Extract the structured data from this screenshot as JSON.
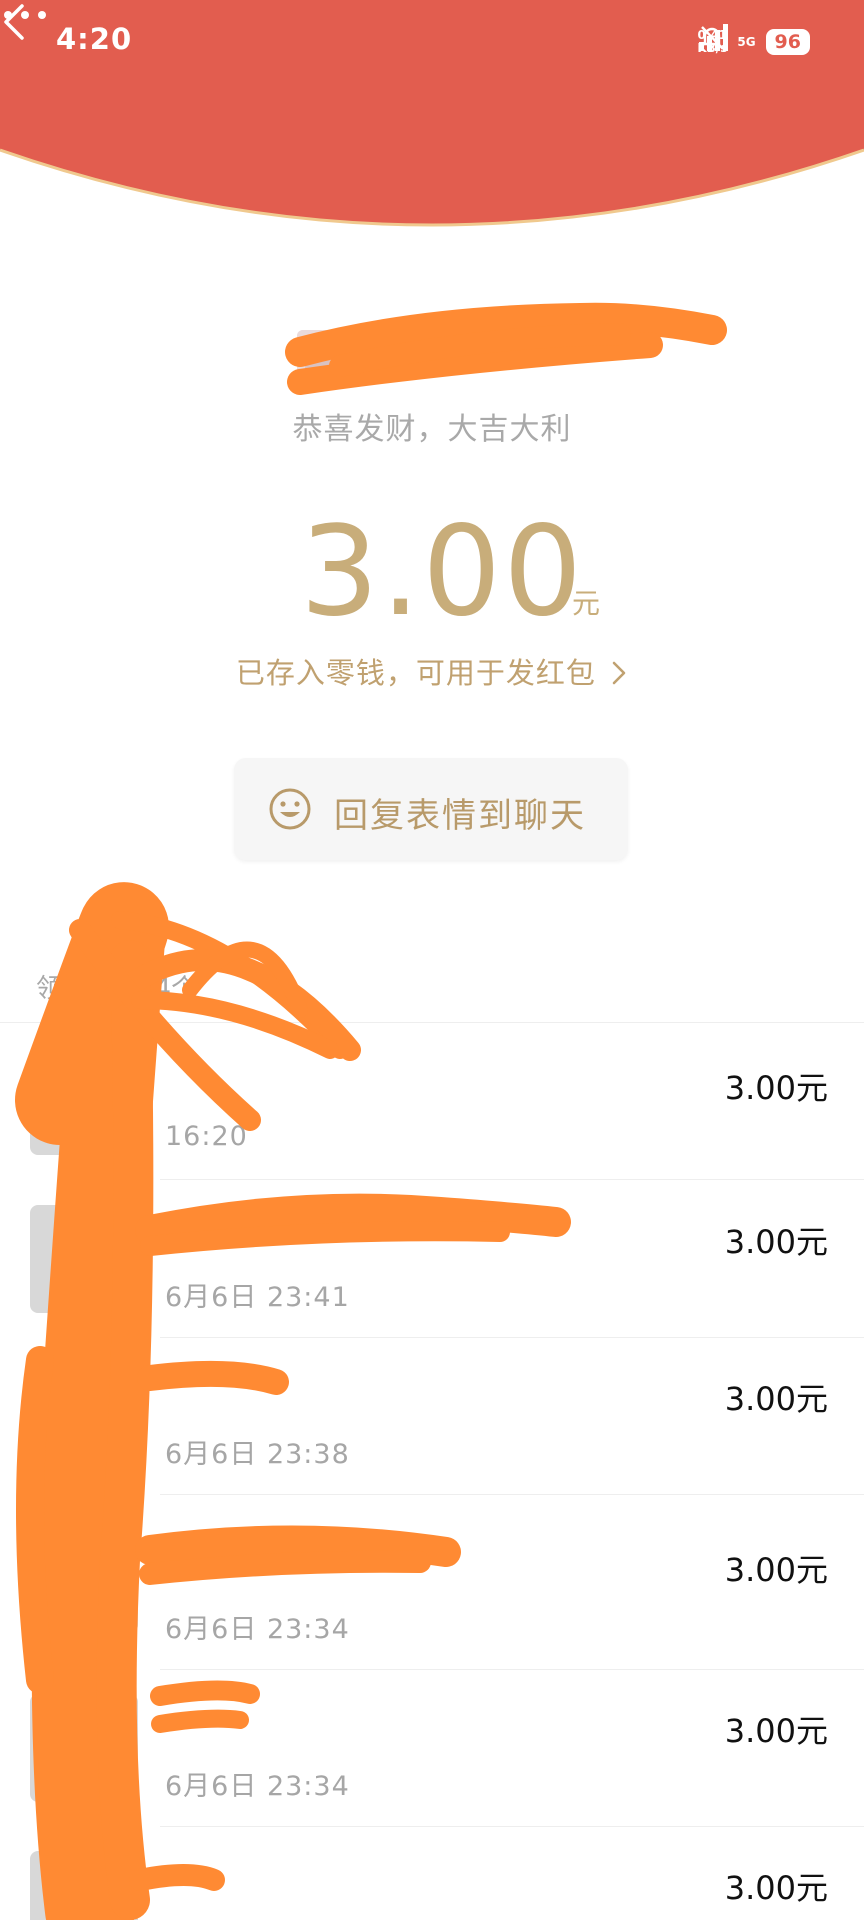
{
  "status_bar": {
    "time": "4:20",
    "net_speed_value": "0.41",
    "net_speed_unit": "KB/s",
    "network": "5G",
    "battery": "96"
  },
  "nav": {
    "back_icon": "chevron-left-icon",
    "more_icon": "more-dots-icon"
  },
  "packet": {
    "greeting": "恭喜发财，大吉大利",
    "amount": "3.00",
    "amount_unit": "元",
    "saved_note": "已存入零钱，可用于发红包",
    "reply_button": "回复表情到聊天"
  },
  "receivers": {
    "header": "领取",
    "header_tail": "34个",
    "items": [
      {
        "name": "",
        "time": "16:20",
        "amount": "3.00元"
      },
      {
        "name": "",
        "time": "6月6日  23:41",
        "amount": "3.00元"
      },
      {
        "name": "",
        "time": "6月6日  23:38",
        "amount": "3.00元"
      },
      {
        "name": "",
        "time": "6月6日  23:34",
        "amount": "3.00元"
      },
      {
        "name": "",
        "time": "6月6日  23:34",
        "amount": "3.00元"
      },
      {
        "name": "",
        "time": "",
        "amount": "3.00元"
      }
    ]
  },
  "colors": {
    "header_red": "#e25d4f",
    "gold": "#c8ad7a",
    "redaction": "#ff8a33"
  }
}
